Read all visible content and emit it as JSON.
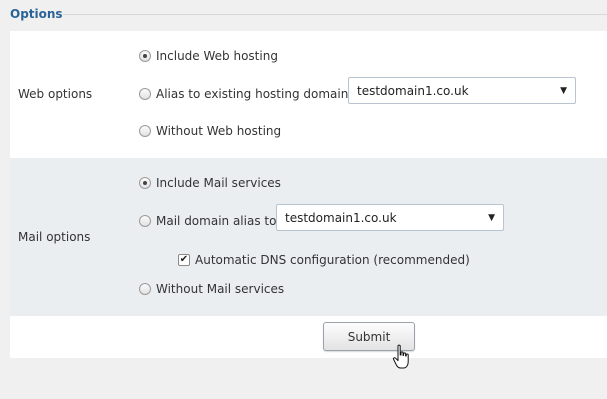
{
  "section": {
    "legend": "Options"
  },
  "web": {
    "label": "Web options",
    "include": "Include Web hosting",
    "alias": "Alias to existing hosting domain",
    "alias_domain": "testdomain1.co.uk",
    "without": "Without Web hosting",
    "selected": "include"
  },
  "mail": {
    "label": "Mail options",
    "include": "Include Mail services",
    "alias": "Mail domain alias to",
    "alias_domain": "testdomain1.co.uk",
    "dns": "Automatic DNS configuration (recommended)",
    "dns_checked": true,
    "without": "Without Mail services",
    "selected": "include"
  },
  "actions": {
    "submit": "Submit"
  },
  "icons": {
    "cursor": "hand-pointer-icon",
    "dropdown": "caret-down-icon"
  }
}
